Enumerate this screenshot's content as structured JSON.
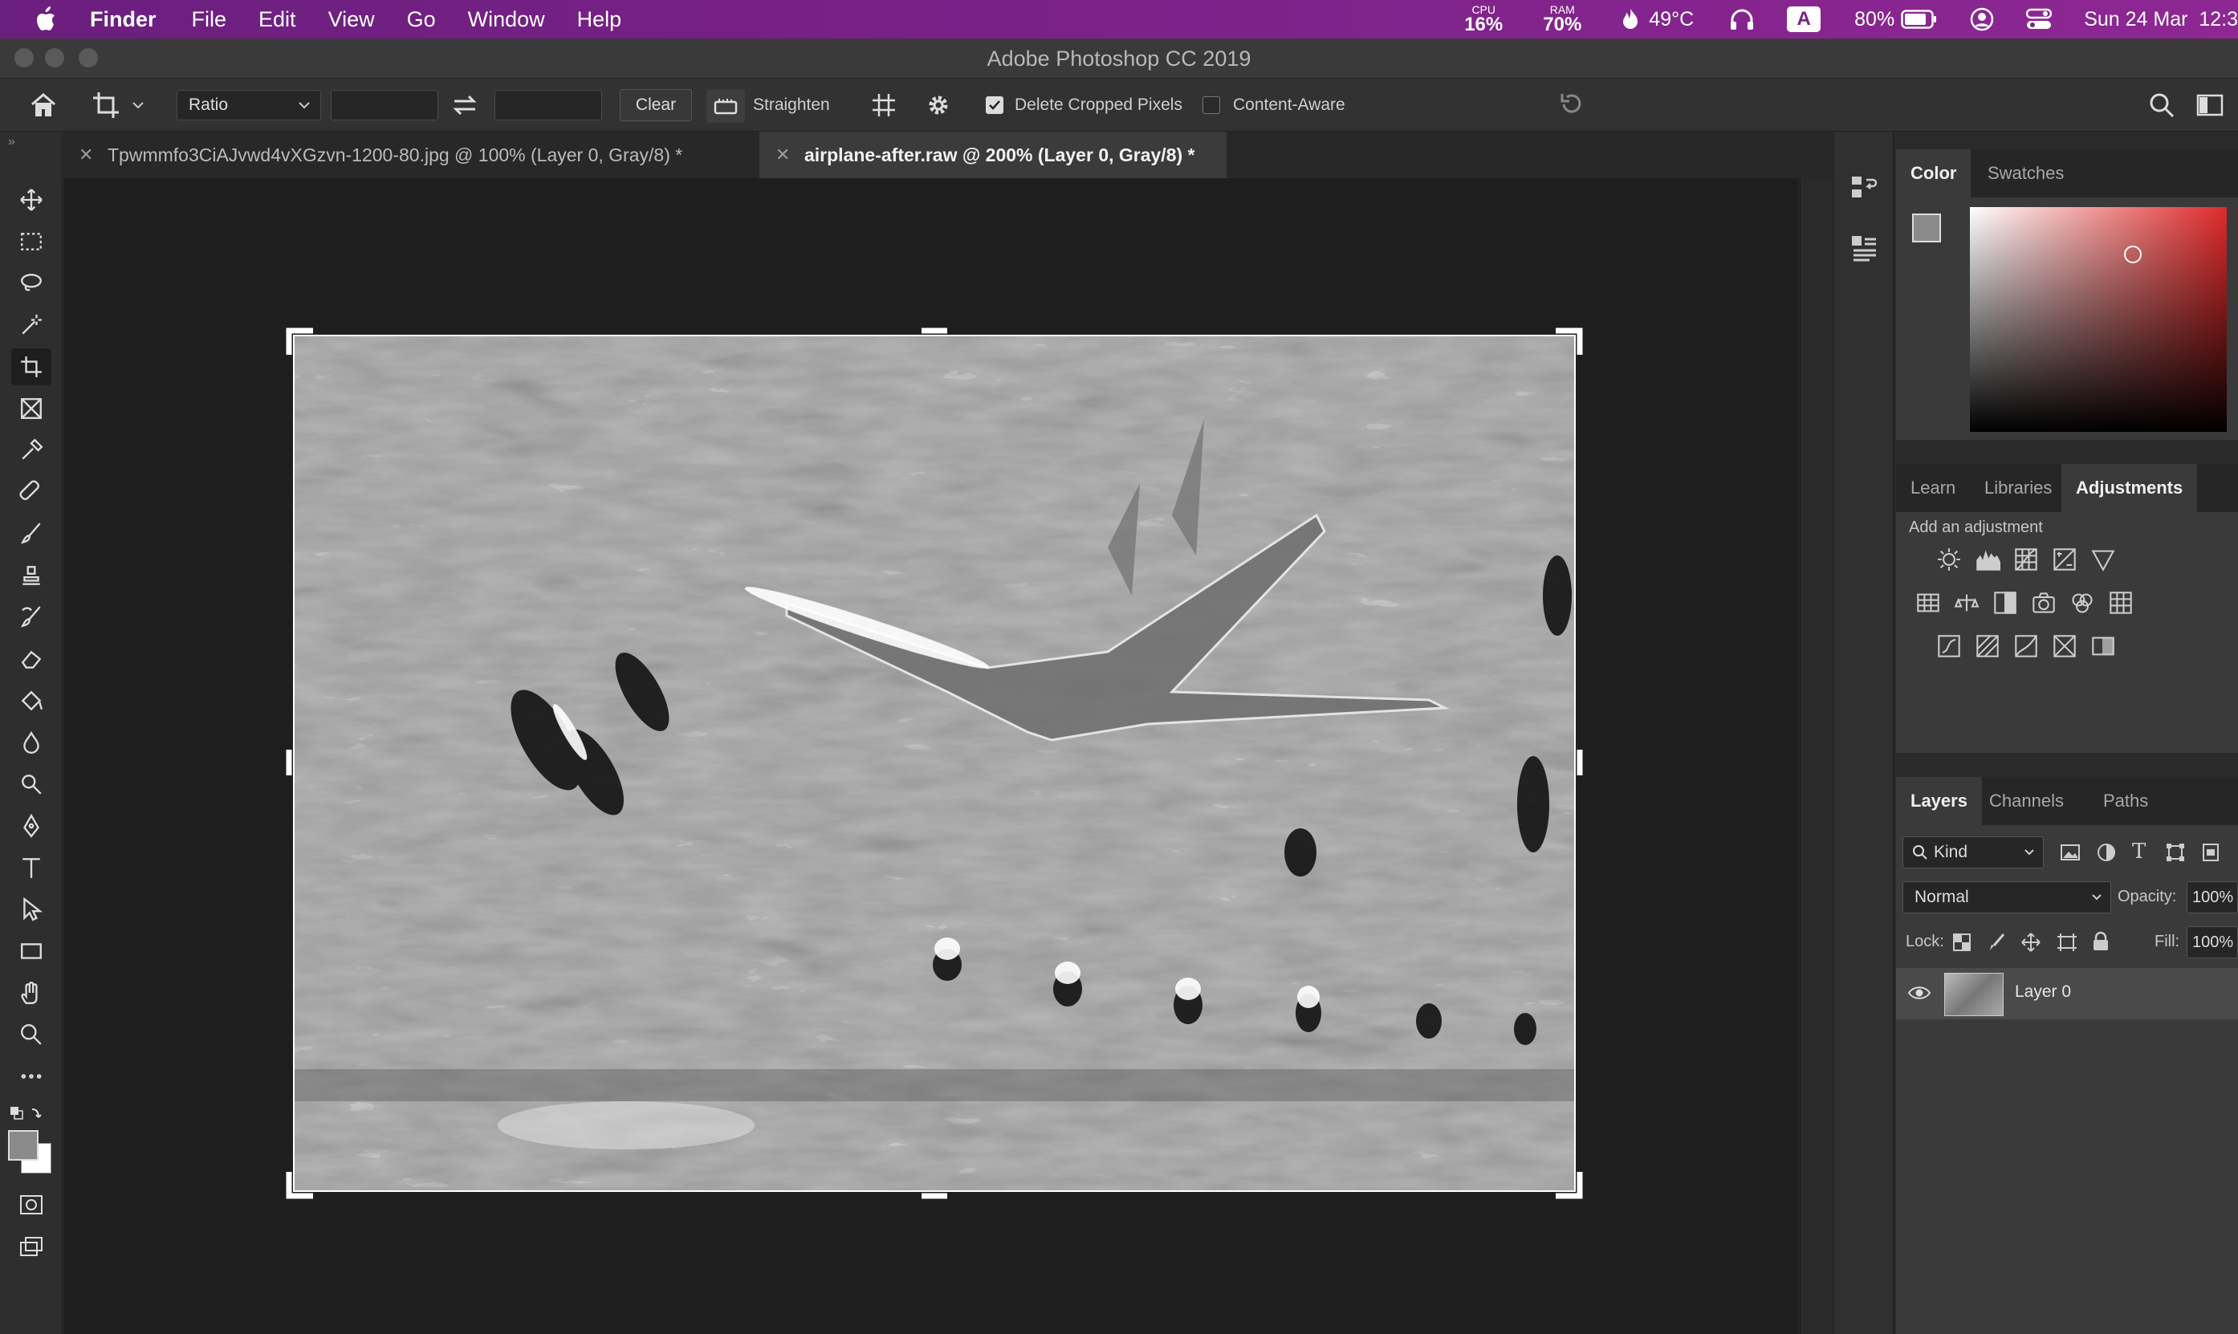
{
  "menubar": {
    "app": "Finder",
    "menus": [
      "File",
      "Edit",
      "View",
      "Go",
      "Window",
      "Help"
    ],
    "cpu_label": "CPU",
    "cpu_value": "16%",
    "ram_label": "RAM",
    "ram_value": "70%",
    "temp": "49°C",
    "input_source": "A",
    "battery": "80%",
    "clock": "Sun 24 Mar  12:3"
  },
  "window": {
    "title": "Adobe Photoshop CC 2019"
  },
  "options": {
    "ratio_value": "Ratio",
    "clear_label": "Clear",
    "straighten_label": "Straighten",
    "delete_cropped_label": "Delete Cropped Pixels",
    "delete_cropped_checked": true,
    "content_aware_label": "Content-Aware",
    "content_aware_checked": false
  },
  "tabs": [
    {
      "label": "Tpwmmfo3CiAJvwd4vXGzvn-1200-80.jpg @ 100% (Layer 0, Gray/8) *",
      "active": false
    },
    {
      "label": "airplane-after.raw @ 200% (Layer 0, Gray/8) *",
      "active": true
    }
  ],
  "tools": [
    "move-tool",
    "marquee-tool",
    "lasso-tool",
    "magic-wand-tool",
    "crop-tool",
    "frame-tool",
    "eyedropper-tool",
    "healing-brush-tool",
    "brush-tool",
    "clone-stamp-tool",
    "history-brush-tool",
    "eraser-tool",
    "paint-bucket-tool",
    "blur-tool",
    "dodge-tool",
    "pen-tool",
    "type-tool",
    "path-selection-tool",
    "rectangle-tool",
    "hand-tool",
    "zoom-tool",
    "more-tools"
  ],
  "color_panel": {
    "tabs": [
      "Color",
      "Swatches"
    ],
    "hue": "#e02a2a",
    "foreground": "#8a8a8a",
    "background": "#ffffff"
  },
  "adjustments_panel": {
    "tabs": [
      "Learn",
      "Libraries",
      "Adjustments"
    ],
    "hint": "Add an adjustment",
    "rows": [
      [
        "brightness-contrast-icon",
        "levels-icon",
        "curves-icon",
        "exposure-icon",
        "vibrance-icon"
      ],
      [
        "hue-saturation-icon",
        "color-balance-icon",
        "black-white-icon",
        "photo-filter-icon",
        "channel-mixer-icon",
        "color-lookup-icon"
      ],
      [
        "invert-icon",
        "posterize-icon",
        "threshold-icon",
        "selective-color-icon",
        "gradient-map-icon"
      ]
    ]
  },
  "layers_panel": {
    "tabs": [
      "Layers",
      "Channels",
      "Paths"
    ],
    "filter_kind": "Kind",
    "blend_mode": "Normal",
    "opacity_label": "Opacity:",
    "opacity": "100%",
    "lock_label": "Lock:",
    "fill_label": "Fill:",
    "fill": "100%",
    "layers": [
      {
        "name": "Layer 0",
        "visible": true
      }
    ]
  }
}
